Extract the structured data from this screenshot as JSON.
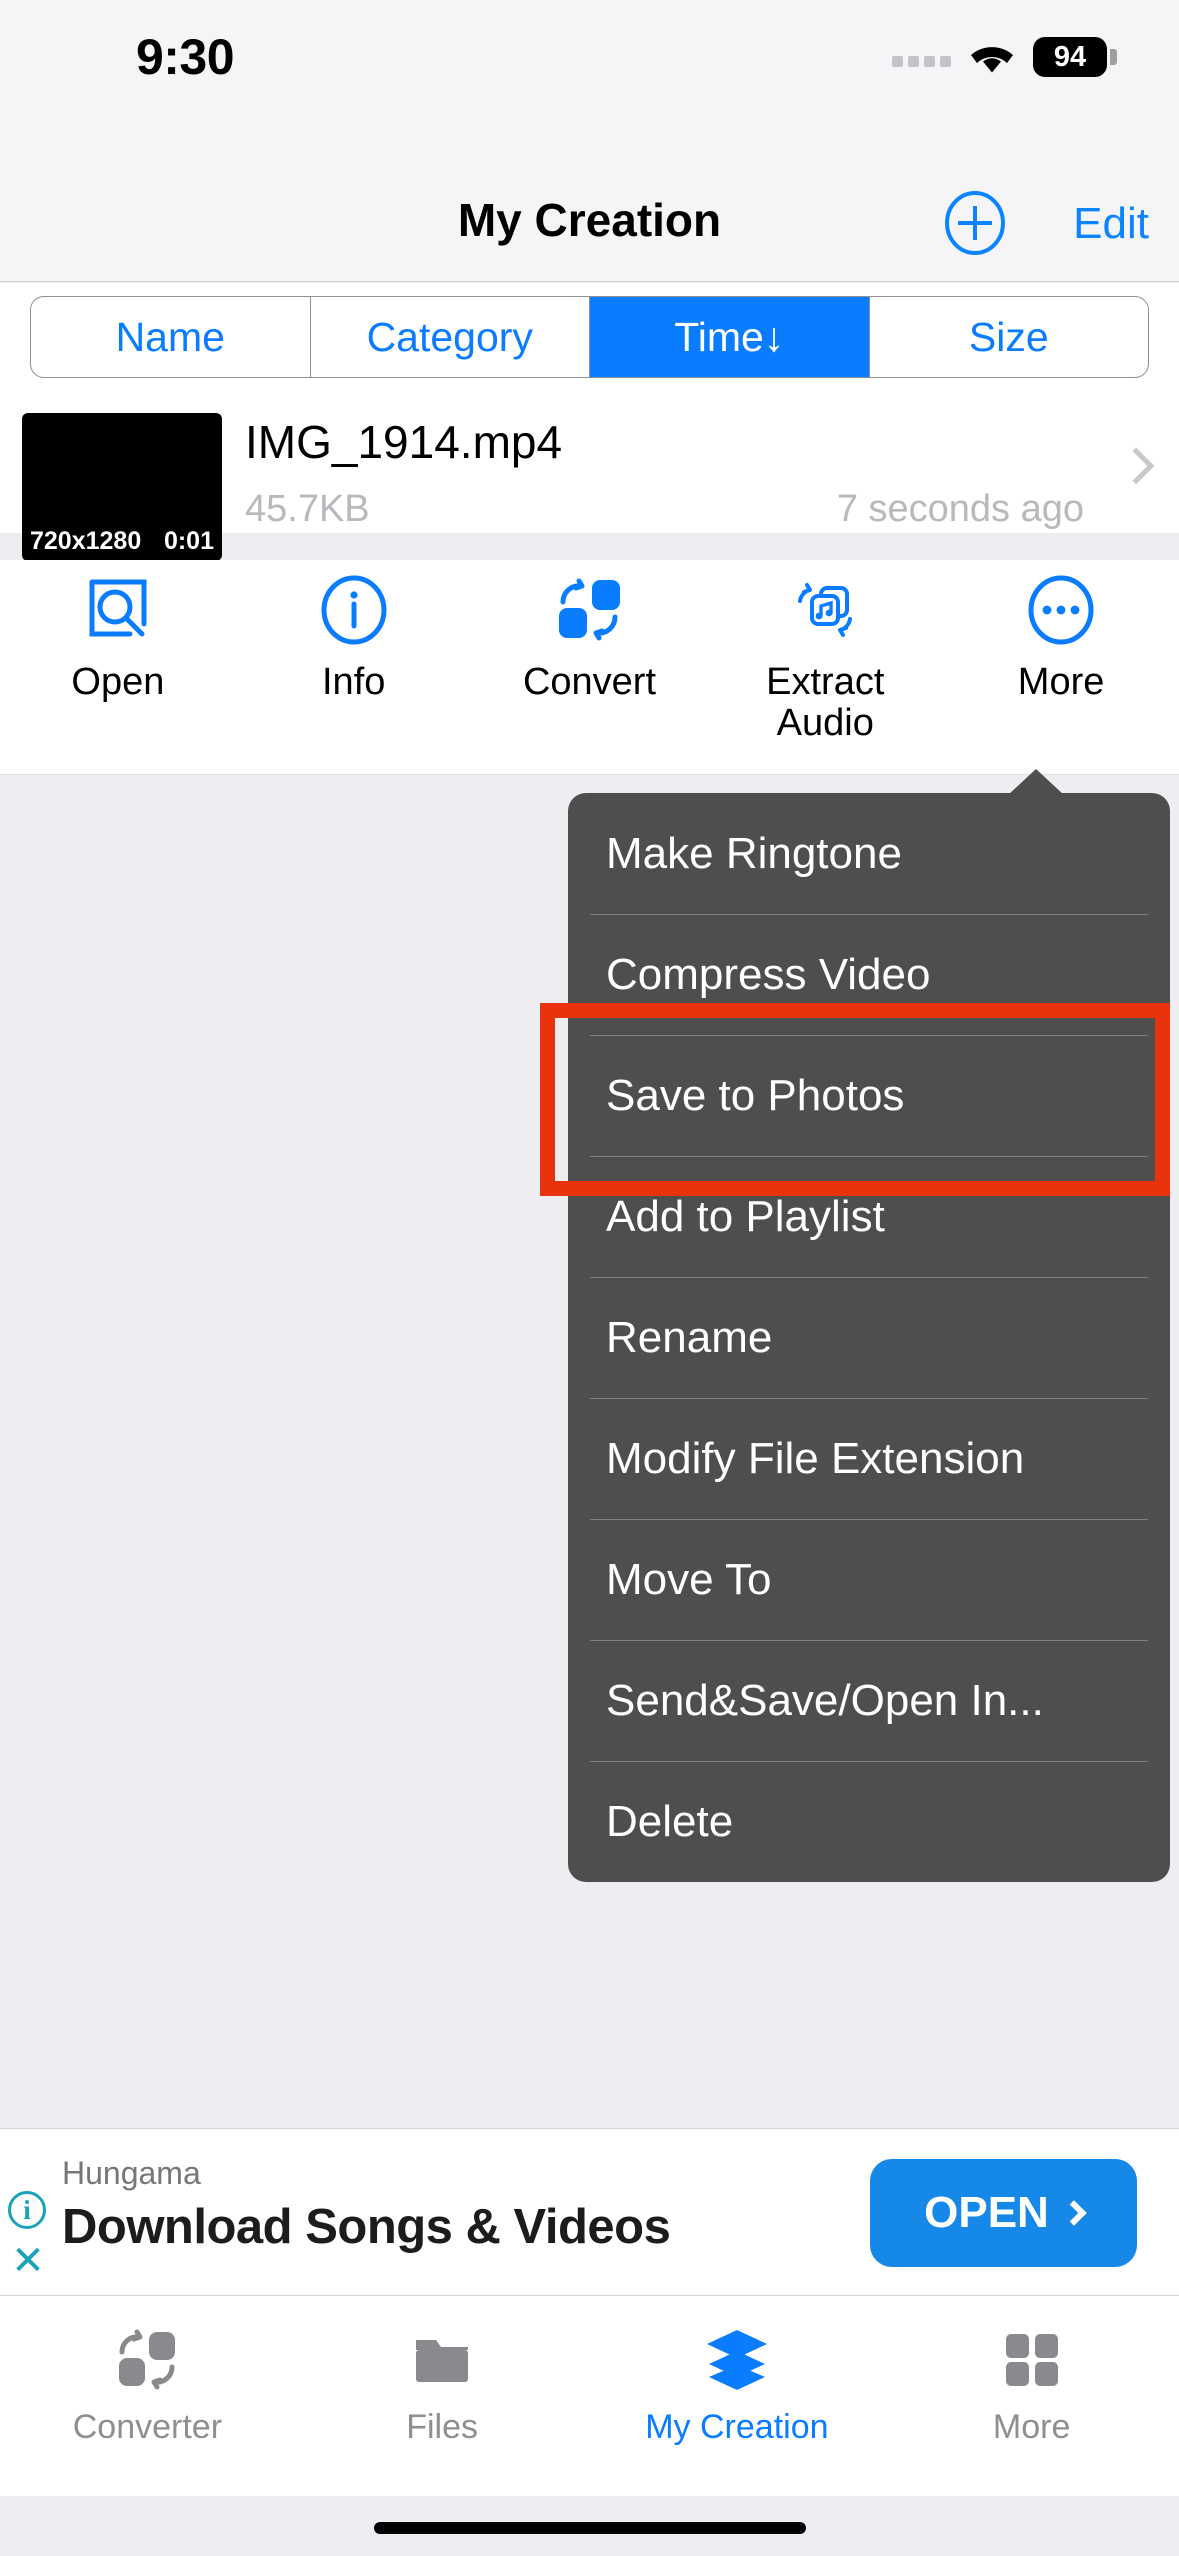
{
  "status_bar": {
    "time": "9:30",
    "battery_level": "94",
    "wifi_icon": "wifi-icon",
    "signal_icon": "signal-dots-icon"
  },
  "nav": {
    "title": "My Creation",
    "add_icon": "plus-circle-icon",
    "edit_label": "Edit"
  },
  "sort_segments": [
    {
      "label": "Name",
      "active": false
    },
    {
      "label": "Category",
      "active": false
    },
    {
      "label": "Time↓",
      "active": true
    },
    {
      "label": "Size",
      "active": false
    }
  ],
  "file": {
    "name": "IMG_1914.mp4",
    "size": "45.7KB",
    "time": "7 seconds ago",
    "thumb_resolution": "720x1280",
    "thumb_duration": "0:01",
    "disclosure_icon": "chevron-right-icon"
  },
  "actions": [
    {
      "label": "Open",
      "icon": "document-search-icon"
    },
    {
      "label": "Info",
      "icon": "info-circle-icon"
    },
    {
      "label": "Convert",
      "icon": "convert-icon"
    },
    {
      "label": "Extract\nAudio",
      "line1": "Extract",
      "line2": "Audio",
      "icon": "extract-audio-icon"
    },
    {
      "label": "More",
      "icon": "ellipsis-circle-icon"
    }
  ],
  "popup_menu": {
    "items": [
      {
        "label": "Make Ringtone"
      },
      {
        "label": "Compress Video"
      },
      {
        "label": "Save to Photos",
        "highlighted": true
      },
      {
        "label": "Add to Playlist"
      },
      {
        "label": "Rename"
      },
      {
        "label": "Modify File Extension"
      },
      {
        "label": "Move To"
      },
      {
        "label": "Send&Save/Open In..."
      },
      {
        "label": "Delete"
      }
    ],
    "background_color": "#4e4e4e",
    "highlight_color": "#e8330c"
  },
  "ad": {
    "advertiser": "Hungama",
    "headline": "Download Songs & Videos",
    "cta_label": "OPEN",
    "cta_color": "#1588e8",
    "info_icon": "info-icon",
    "close_icon": "close-icon"
  },
  "tabs": [
    {
      "label": "Converter",
      "icon": "convert-icon",
      "active": false
    },
    {
      "label": "Files",
      "icon": "folder-icon",
      "active": false
    },
    {
      "label": "My Creation",
      "icon": "layers-icon",
      "active": true
    },
    {
      "label": "More",
      "icon": "grid-icon",
      "active": false
    }
  ],
  "theme": {
    "accent": "#0a7cff",
    "muted": "#8e8e93"
  }
}
